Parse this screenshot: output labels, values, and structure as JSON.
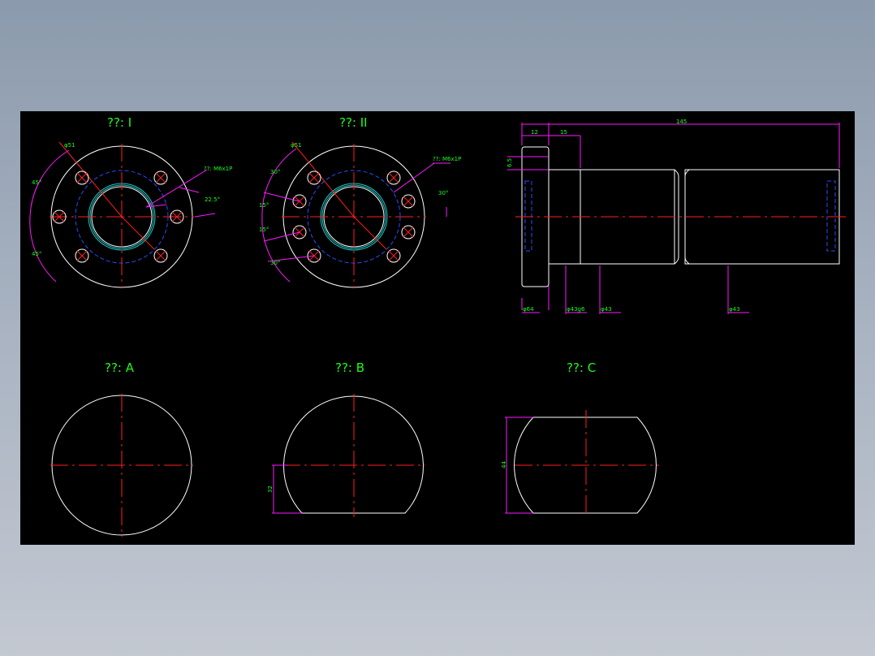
{
  "views": {
    "view_1": {
      "title": "??: I",
      "dims": {
        "bolt_circle": "φ51",
        "thread_note": "??: M6x1P",
        "angle_a": "45°",
        "angle_b": "45°",
        "angle_c": "22.5°"
      }
    },
    "view_2": {
      "title": "??: II",
      "dims": {
        "bolt_circle": "φ51",
        "thread_note": "??: M6x1P",
        "angle_a": "30°",
        "angle_b": "15°",
        "angle_c": "15°",
        "angle_d": "30°",
        "angle_e": "30°"
      }
    },
    "side": {
      "dims": {
        "overall_length": "145",
        "flange_width": "12",
        "step_len": "15",
        "height_small": "6.5",
        "d_flange": "φ64",
        "d_fit": "φ43g6",
        "d_body1": "φ43",
        "d_body2": "φ43"
      }
    },
    "view_a": {
      "title": "??: A"
    },
    "view_b": {
      "title": "??: B",
      "dims": {
        "flat_height": "32"
      }
    },
    "view_c": {
      "title": "??: C",
      "dims": {
        "flat_width": "44"
      }
    }
  },
  "colors": {
    "background": "#000000",
    "outline": "#ffffff",
    "centerline": "#ff1e1e",
    "hidden": "#2b4bff",
    "dimension": "#ff19ff",
    "text": "#19ff19"
  }
}
